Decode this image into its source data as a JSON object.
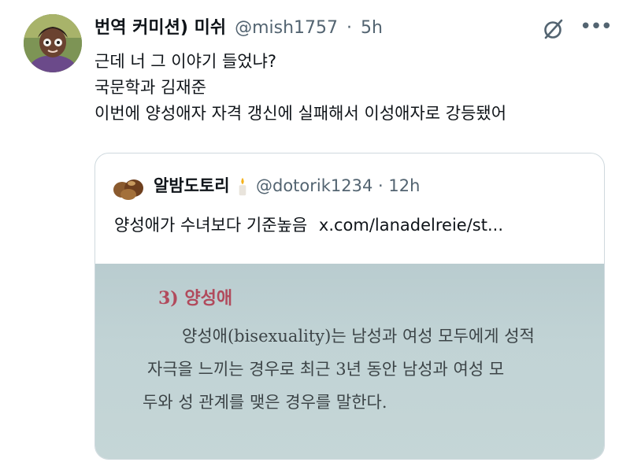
{
  "tweet": {
    "display_name": "번역 커미션) 미쉬",
    "handle": "@mish1757",
    "separator": "·",
    "time": "5h",
    "more_label": "•••",
    "lines": [
      "근데 너 그 이야기 들었냐?",
      "국문학과 김재준",
      "이번에 양성애자 자격 갱신에 실패해서 이성애자로 강등됐어"
    ]
  },
  "quote": {
    "display_name": "알밤도토리",
    "handle": "@dotorik1234",
    "separator": "·",
    "time": "12h",
    "text": "양성애가 수녀보다 기준높음",
    "link": "x.com/lanadelreie/st..."
  },
  "photo": {
    "section_title": "3) 양성애",
    "lines": [
      "양성애(bisexuality)는 남성과 여성 모두에게 성적",
      "자극을 느끼는 경우로 최근 3년 동안 남성과 여성 모",
      "두와 성 관계를 맺은 경우를 말한다."
    ]
  },
  "colors": {
    "text_primary": "#0f1419",
    "text_secondary": "#536471",
    "border": "#cfd9de",
    "section_title": "#b14a5c"
  }
}
